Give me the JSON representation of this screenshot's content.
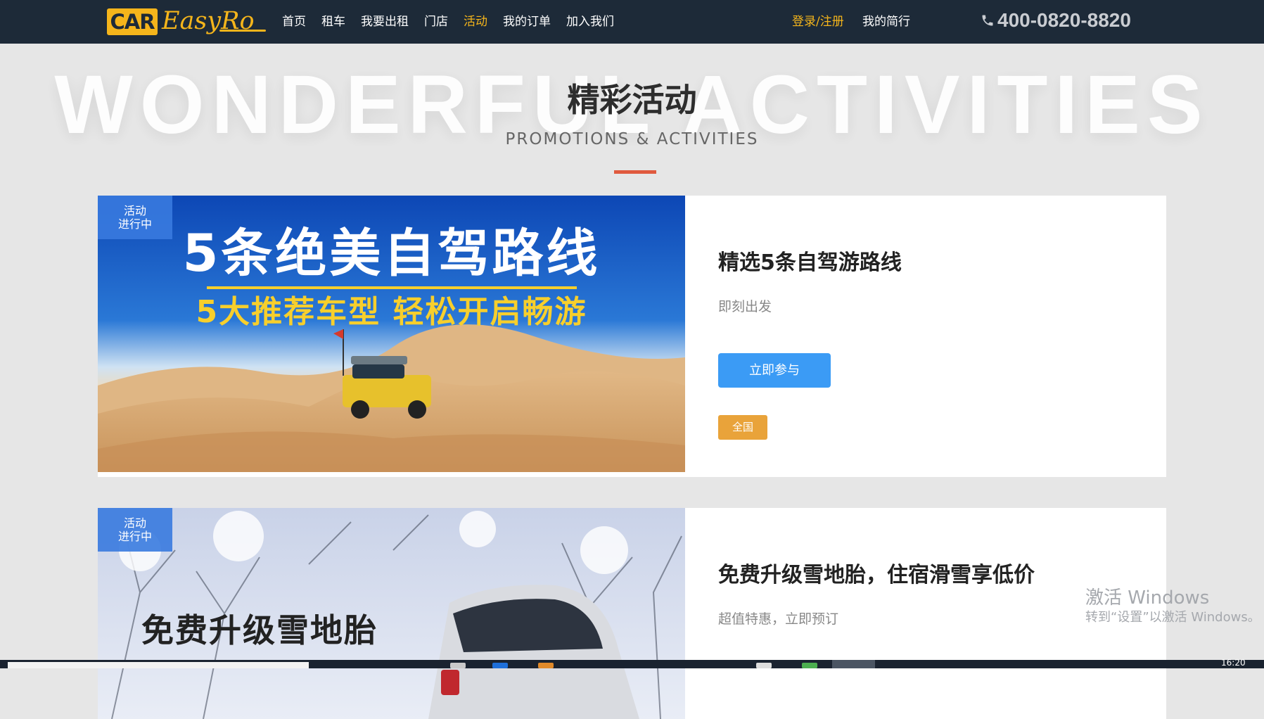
{
  "header": {
    "logo_box": "CAR",
    "logo_word": "EasyRo",
    "nav": [
      "首页",
      "租车",
      "我要出租",
      "门店",
      "活动",
      "我的订单",
      "加入我们"
    ],
    "active_nav": "活动",
    "login": "登录/注册",
    "my_trip": "我的简行",
    "phone": "400-0820-8820"
  },
  "section": {
    "bg_word": "WONDERFUL ACTIVITIES",
    "title": "精彩活动",
    "subtitle": "PROMOTIONS & ACTIVITIES"
  },
  "cards": [
    {
      "badge_line1": "活动",
      "badge_line2": "进行中",
      "banner_line1": "5条绝美自驾路线",
      "banner_line2": "5大推荐车型 轻松开启畅游",
      "title": "精选5条自驾游路线",
      "subtitle": "即刻出发",
      "button": "立即参与",
      "tag": "全国"
    },
    {
      "badge_line1": "活动",
      "badge_line2": "进行中",
      "banner_line1": "免费升级雪地胎",
      "title": "免费升级雪地胎，住宿滑雪享低价",
      "subtitle": "超值特惠，立即预订"
    }
  ],
  "watermark": {
    "line1": "激活 Windows",
    "line2": "转到“设置”以激活 Windows。"
  },
  "taskbar": {
    "clock": "16:20"
  },
  "colors": {
    "header_bg": "#1d2a38",
    "accent_yellow": "#f5b51b",
    "divider_red": "#e05a3e",
    "button_blue": "#3b9bf5",
    "tag_orange": "#e9a33a",
    "badge_blue": "#387adf"
  }
}
